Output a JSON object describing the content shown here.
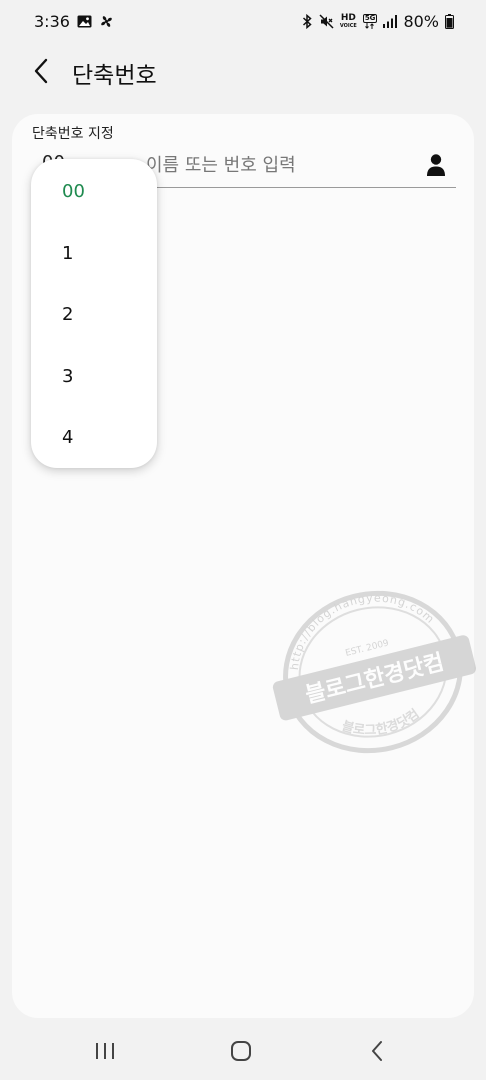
{
  "status_bar": {
    "time": "3:36",
    "hd_voice": "HD",
    "hd_voice_sub": "VOICE",
    "network": "5G",
    "battery_percent": "80%"
  },
  "header": {
    "title": "단축번호"
  },
  "form": {
    "section_label": "단축번호 지정",
    "speed_dial_value": "00",
    "search_placeholder": "이름 또는 번호 입력"
  },
  "dropdown": {
    "options": [
      "00",
      "1",
      "2",
      "3",
      "4"
    ],
    "selected_index": 0,
    "selected_color": "#1f8a4f"
  },
  "watermark": {
    "main_text": "블로그한경닷컴",
    "arc_text": "http://blog.hangyeong.com",
    "est_text": "EST. 2009"
  },
  "navigation": {
    "icons": [
      "recent-apps-icon",
      "home-icon",
      "back-icon"
    ]
  }
}
